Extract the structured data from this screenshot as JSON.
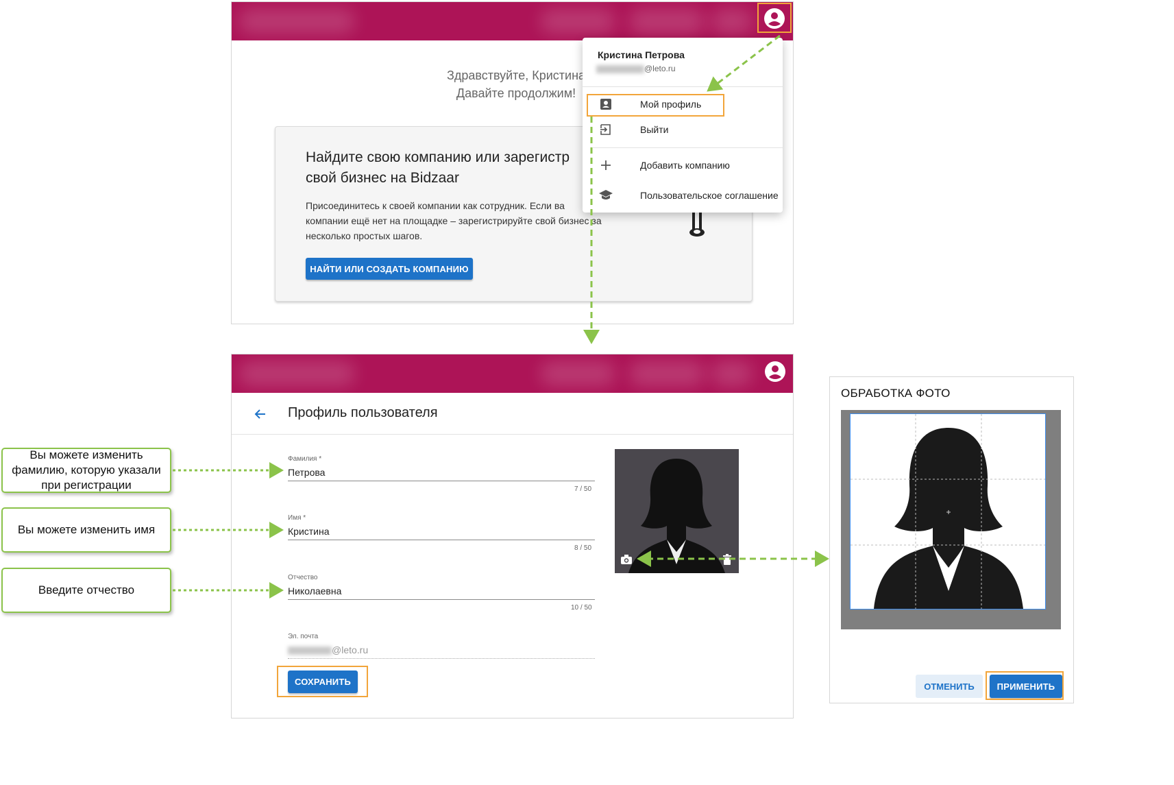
{
  "screen1": {
    "greeting_line1": "Здравствуйте, Кристина",
    "greeting_line2": "Давайте продолжим!",
    "card": {
      "title_line1": "Найдите свою компанию или зарегистр",
      "title_line2": "свой бизнес на Bidzaar",
      "body_line1": "Присоединитесь к своей компании как сотрудник. Если ва",
      "body_line2": "компании ещё нет на площадке – зарегистрируйте свой бизнес за",
      "body_line3": "несколько простых шагов.",
      "button_label": "НАЙТИ ИЛИ СОЗДАТЬ КОМПАНИЮ"
    },
    "menu": {
      "user_name": "Кристина Петрова",
      "user_email": "@leto.ru",
      "items": [
        {
          "label": "Мой профиль",
          "icon": "account-box-icon"
        },
        {
          "label": "Выйти",
          "icon": "logout-icon"
        },
        {
          "label": "Добавить компанию",
          "icon": "plus-icon"
        },
        {
          "label": "Пользовательское соглашение",
          "icon": "school-icon"
        }
      ]
    }
  },
  "screen2": {
    "page_title": "Профиль пользователя",
    "fields": [
      {
        "label": "Фамилия *",
        "value": "Петрова",
        "counter": "7 / 50"
      },
      {
        "label": "Имя *",
        "value": "Кристина",
        "counter": "8 / 50"
      },
      {
        "label": "Отчество",
        "value": "Николаевна",
        "counter": "10 / 50"
      },
      {
        "label": "Эл. почта",
        "value": "@leto.ru"
      }
    ],
    "save_button": "СОХРАНИТЬ"
  },
  "photo_dialog": {
    "title": "ОБРАБОТКА ФОТО",
    "cancel": "ОТМЕНИТЬ",
    "apply": "ПРИМЕНИТЬ"
  },
  "callouts": {
    "surname": "Вы можете изменить фамилию, которую указали при регистрации",
    "name": "Вы можете изменить имя",
    "patronymic": "Введите отчество"
  },
  "colors": {
    "brand": "#ad1457",
    "primary_button": "#1e73c8",
    "highlight": "#f2a53a",
    "annotation": "#8bc34a"
  }
}
